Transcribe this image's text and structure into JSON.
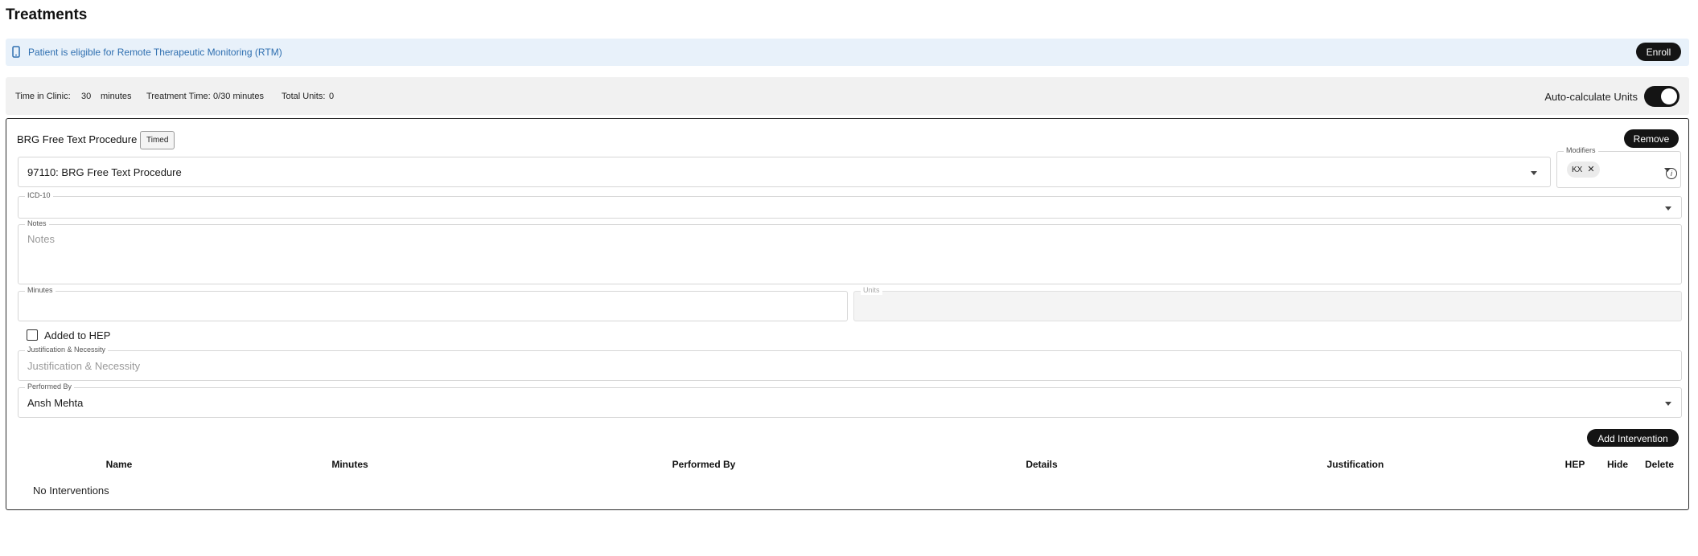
{
  "page": {
    "title": "Treatments"
  },
  "banner": {
    "icon": "phone-icon",
    "text": "Patient is eligible for Remote Therapeutic Monitoring (RTM)",
    "enroll_label": "Enroll",
    "bg_color": "#e8f1fa",
    "text_color": "#2f6fb0"
  },
  "summary": {
    "time_in_clinic_label": "Time in Clinic:",
    "time_in_clinic_value": "30",
    "time_in_clinic_unit": "minutes",
    "treatment_time_label": "Treatment Time:",
    "treatment_time_value": "0/30 minutes",
    "total_units_label": "Total Units:",
    "total_units_value": "0",
    "auto_calc_label": "Auto-calculate Units",
    "auto_calc_on": true
  },
  "procedure": {
    "name": "BRG Free Text Procedure",
    "badge": "Timed",
    "remove_label": "Remove",
    "code_value": "97110: BRG Free Text Procedure",
    "modifiers_label": "Modifiers",
    "modifier_chips": [
      "KX"
    ],
    "icd_label": "ICD-10",
    "icd_value": "",
    "notes_label": "Notes",
    "notes_placeholder": "Notes",
    "minutes_label": "Minutes",
    "minutes_value": "",
    "units_label": "Units",
    "units_value": "",
    "hep_label": "Added to HEP",
    "hep_checked": false,
    "justification_label": "Justification & Necessity",
    "justification_placeholder": "Justification & Necessity",
    "performed_by_label": "Performed By",
    "performed_by_value": "Ansh Mehta"
  },
  "interventions": {
    "add_label": "Add Intervention",
    "columns": [
      "Name",
      "Minutes",
      "Performed By",
      "Details",
      "Justification",
      "HEP",
      "Hide",
      "Delete"
    ],
    "empty_text": "No Interventions"
  }
}
